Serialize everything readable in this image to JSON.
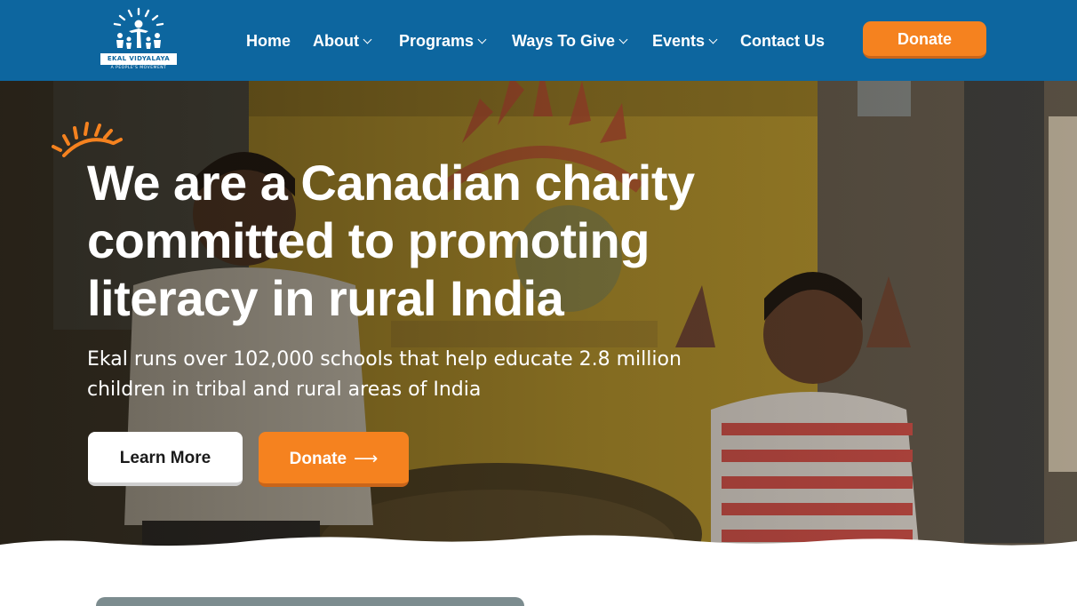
{
  "header": {
    "logo": {
      "name": "EKAL VIDYALAYA",
      "tagline": "A PEOPLE'S MOVEMENT",
      "icon": "ekal-sun-logo"
    },
    "nav": [
      {
        "label": "Home",
        "has_dropdown": false
      },
      {
        "label": "About",
        "has_dropdown": true
      },
      {
        "label": "Programs",
        "has_dropdown": true
      },
      {
        "label": "Ways To Give",
        "has_dropdown": true
      },
      {
        "label": "Events",
        "has_dropdown": true
      },
      {
        "label": "Contact Us",
        "has_dropdown": false
      }
    ],
    "donate_label": "Donate"
  },
  "hero": {
    "headline": "We are a Canadian charity committed to promoting literacy in rural India",
    "subtext": "Ekal runs over 102,000 schools that help educate 2.8 million children in tribal and rural areas of India",
    "learn_more_label": "Learn More",
    "donate_label": "Donate",
    "donate_arrow": "⟶"
  },
  "colors": {
    "header_bg": "#0d669f",
    "accent_orange": "#f5821f",
    "text_white": "#ffffff"
  }
}
